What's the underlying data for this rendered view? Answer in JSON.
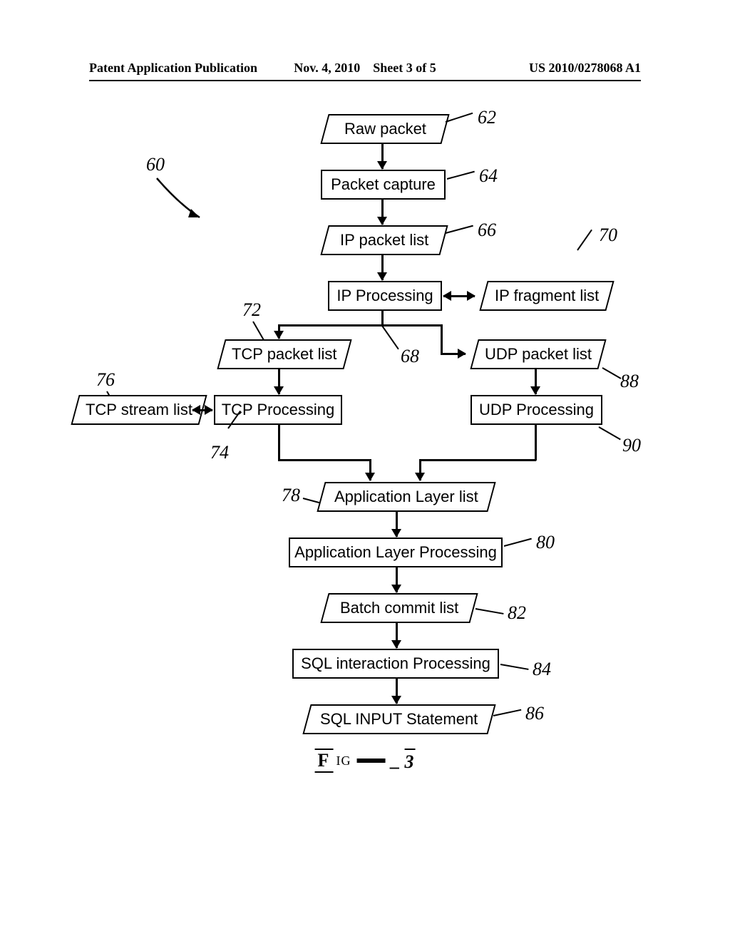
{
  "header": {
    "left": "Patent Application Publication",
    "date": "Nov. 4, 2010",
    "sheet": "Sheet 3 of 5",
    "pubno": "US 2010/0278068 A1"
  },
  "nodes": {
    "raw_packet": "Raw packet",
    "packet_capture": "Packet capture",
    "ip_packet_list": "IP packet list",
    "ip_processing": "IP Processing",
    "ip_fragment_list": "IP fragment list",
    "tcp_packet_list": "TCP packet list",
    "udp_packet_list": "UDP packet list",
    "tcp_processing": "TCP Processing",
    "tcp_stream_list": "TCP stream list",
    "udp_processing": "UDP Processing",
    "app_layer_list": "Application Layer list",
    "app_layer_proc": "Application Layer Processing",
    "batch_commit": "Batch commit list",
    "sql_interaction": "SQL interaction Processing",
    "sql_input": "SQL INPUT Statement"
  },
  "refs": {
    "r60": "60",
    "r62": "62",
    "r64": "64",
    "r66": "66",
    "r68": "68",
    "r70": "70",
    "r72": "72",
    "r74": "74",
    "r76": "76",
    "r78": "78",
    "r80": "80",
    "r82": "82",
    "r84": "84",
    "r86": "86",
    "r88": "88",
    "r90": "90"
  },
  "figure": {
    "prefix": "F",
    "mid": "IG",
    "suffix": "3"
  }
}
